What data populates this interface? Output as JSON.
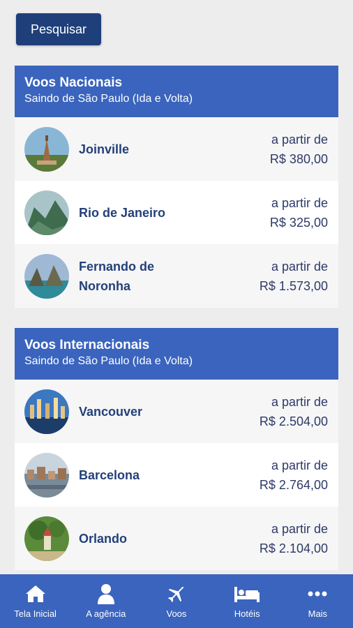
{
  "search": {
    "label": "Pesquisar"
  },
  "sections": [
    {
      "title": "Voos Nacionais",
      "subtitle": "Saindo de São Paulo (Ida e Volta)",
      "items": [
        {
          "city": "Joinville",
          "prefix": "a partir de",
          "price": "R$ 380,00"
        },
        {
          "city": "Rio de Janeiro",
          "prefix": "a partir de",
          "price": "R$ 325,00"
        },
        {
          "city": "Fernando de Noronha",
          "prefix": "a partir de",
          "price": "R$ 1.573,00"
        }
      ]
    },
    {
      "title": "Voos Internacionais",
      "subtitle": "Saindo de São Paulo (Ida e Volta)",
      "items": [
        {
          "city": "Vancouver",
          "prefix": "a partir de",
          "price": "R$ 2.504,00"
        },
        {
          "city": "Barcelona",
          "prefix": "a partir de",
          "price": "R$ 2.764,00"
        },
        {
          "city": "Orlando",
          "prefix": "a partir de",
          "price": "R$ 2.104,00"
        }
      ]
    }
  ],
  "nav": [
    {
      "label": "Tela Inicial",
      "icon": "home-icon"
    },
    {
      "label": "A agência",
      "icon": "user-icon"
    },
    {
      "label": "Voos",
      "icon": "plane-icon"
    },
    {
      "label": "Hotéis",
      "icon": "bed-icon"
    },
    {
      "label": "Mais",
      "icon": "more-icon"
    }
  ],
  "colors": {
    "header": "#3a64bd",
    "button": "#1e3f7a",
    "city_text": "#24407a"
  }
}
